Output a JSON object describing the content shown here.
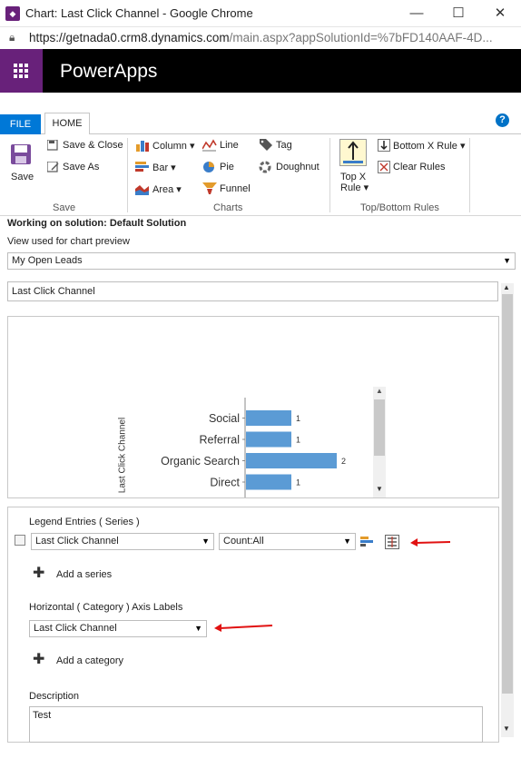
{
  "window": {
    "title": "Chart: Last Click Channel - Google Chrome",
    "app_icon": "powerapps-icon"
  },
  "address_bar": {
    "url_host": "https://getnada0.crm8.dynamics.com",
    "url_rest": "/main.aspx?appSolutionId=%7bFD140AAF-4D..."
  },
  "app_header": {
    "title": "PowerApps"
  },
  "ribbon": {
    "tabs": {
      "file": "FILE",
      "home": "HOME"
    },
    "save_group": {
      "save": "Save",
      "save_close": "Save & Close",
      "save_as": "Save As",
      "group_label": "Save"
    },
    "charts_group": {
      "column": "Column",
      "bar": "Bar",
      "area": "Area",
      "line": "Line",
      "pie": "Pie",
      "funnel": "Funnel",
      "tag": "Tag",
      "doughnut": "Doughnut",
      "group_label": "Charts"
    },
    "topbottom_group": {
      "top_x_line1": "Top X",
      "top_x_line2": "Rule",
      "bottom_x": "Bottom X Rule",
      "clear_rules": "Clear Rules",
      "group_label": "Top/Bottom Rules"
    },
    "colors": {
      "file_tab": "#0078d7",
      "help": "#0072c6"
    }
  },
  "solution": {
    "working_on": "Working on solution: Default Solution",
    "view_label": "View used for chart preview",
    "view_selected": "My Open Leads",
    "chart_name": "Last Click Channel"
  },
  "chart_data": {
    "type": "bar",
    "ylabel": "Last Click Channel",
    "categories": [
      "Social",
      "Referral",
      "Organic Search",
      "Direct"
    ],
    "values": [
      1,
      1,
      2,
      1
    ],
    "bar_color": "#5b9bd5"
  },
  "series_panel": {
    "legend_label": "Legend Entries ( Series )",
    "series_field": "Last Click Channel",
    "series_aggregate": "Count:All",
    "add_series": "Add a series",
    "category_label": "Horizontal ( Category ) Axis Labels",
    "category_field": "Last Click Channel",
    "add_category": "Add a category",
    "description_label": "Description",
    "description_value": "Test"
  },
  "annotation_color": "#e11111"
}
